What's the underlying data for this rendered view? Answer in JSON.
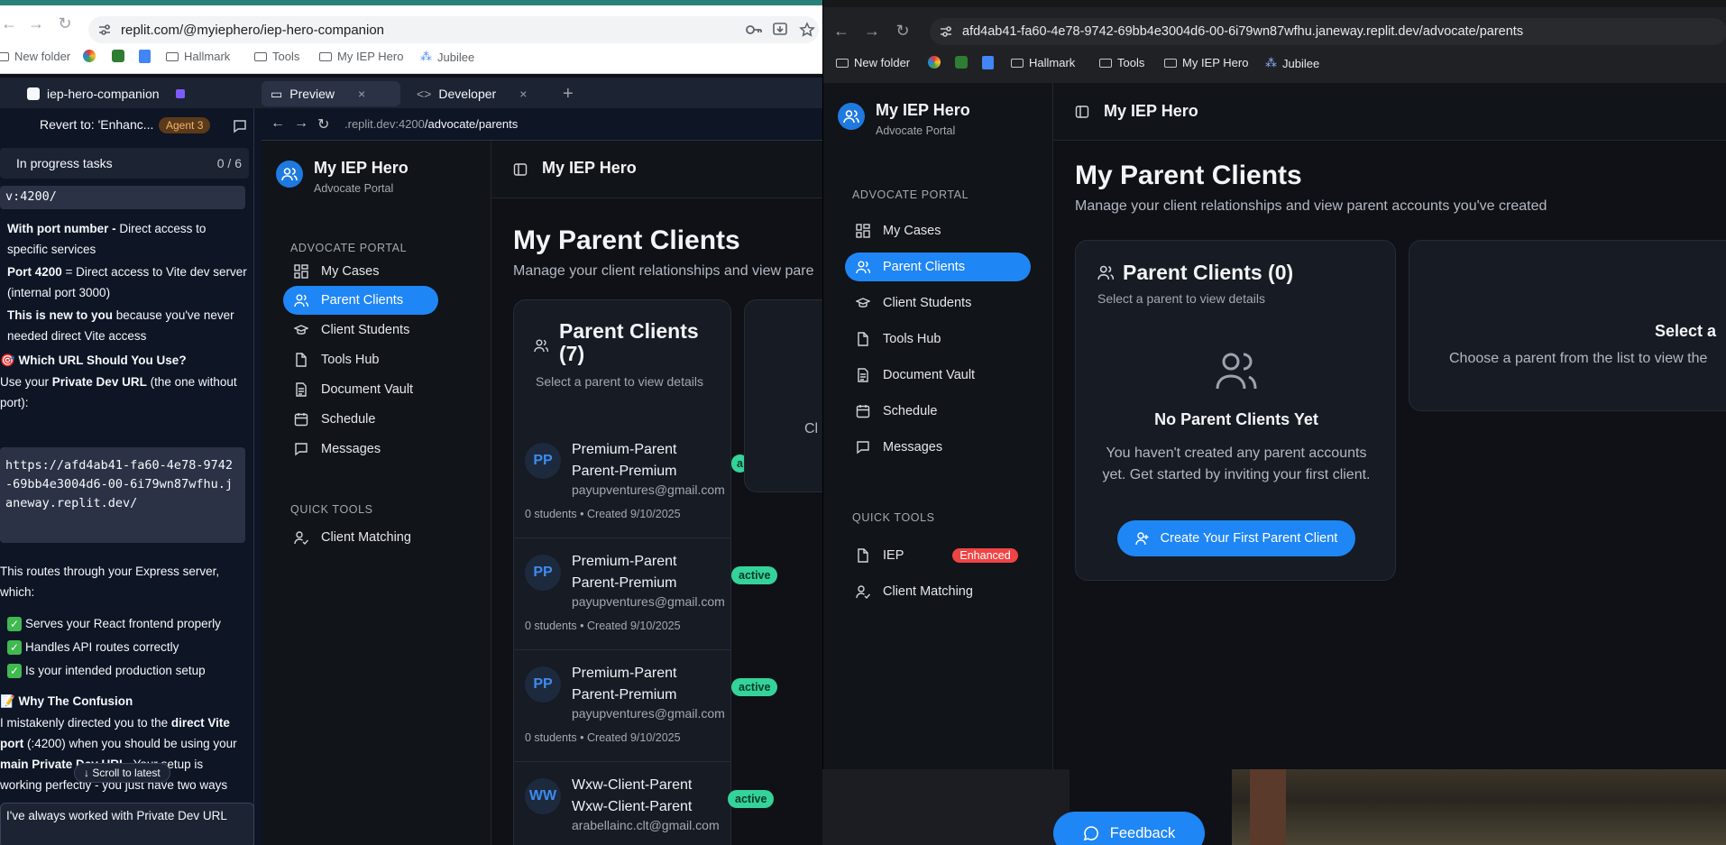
{
  "left_browser": {
    "url": "replit.com/@myiephero/iep-hero-companion",
    "bookmarks": [
      "New folder",
      "Hallmark",
      "Tools",
      "My IEP Hero",
      "Jubilee"
    ]
  },
  "replit": {
    "project_tab": "iep-hero-companion",
    "tabs": [
      "Preview",
      "Developer"
    ],
    "revert_label": "Revert to: 'Enhanc...",
    "agent_badge": "Agent 3",
    "tasks_label": "In progress tasks",
    "tasks_count": "0 / 6",
    "chat": {
      "code_tail": "v:4200/",
      "p1_b": "With port number -",
      "p1": " Direct access to specific services",
      "p2_b": "Port 4200",
      "p2": " = Direct access to Vite dev server (internal port 3000)",
      "p3_b": "This is new to you",
      "p3": " because you've never needed direct Vite access",
      "h1": "🎯 Which URL Should You Use?",
      "p4_a": "Use your ",
      "p4_b": "Private Dev URL",
      "p4_c": " (the one without port):",
      "code": "https://afd4ab41-fa60-4e78-9742-69bb4e3004d6-00-6i79wn87wfhu.janeway.replit.dev/",
      "p5": "This routes through your Express server, which:",
      "check1": "Serves your React frontend properly",
      "check2": "Handles API routes correctly",
      "check3": "Is your intended production setup",
      "h2": "📝 Why The Confusion",
      "p6_a": "I mistakenly directed you to the ",
      "p6_b": "direct Vite port",
      "p6_c": " (:4200) when you should be using your ",
      "p6_d": "main Private Dev URL",
      "p6_e": ". Your setup is working perfectly - you just have two ways",
      "scroll_latest": "Scroll to latest",
      "input_text": "I've always worked with Private Dev URL"
    },
    "preview_url_dim": ".replit.dev:4200",
    "preview_url_path": "/advocate/parents"
  },
  "app_left": {
    "brand": "My IEP Hero",
    "brand_sub": "Advocate Portal",
    "section_portal": "ADVOCATE PORTAL",
    "nav": [
      "My Cases",
      "Parent Clients",
      "Client Students",
      "Tools Hub",
      "Document Vault",
      "Schedule",
      "Messages"
    ],
    "section_tools": "QUICK TOOLS",
    "tools": [
      "Client Matching"
    ],
    "header_title": "My IEP Hero",
    "page_title": "My Parent Clients",
    "page_subtitle": "Manage your client relationships and view pare",
    "card_title": "Parent Clients (7)",
    "card_subtitle": "Select a parent to view details",
    "right_card_text": "Cl",
    "clients": [
      {
        "initials": "PP",
        "name": "Premium-Parent Parent-Premium",
        "email": "payupventures@gmail.com",
        "meta": "0 students • Created 9/10/2025",
        "status": "a"
      },
      {
        "initials": "PP",
        "name": "Premium-Parent Parent-Premium",
        "email": "payupventures@gmail.com",
        "meta": "0 students • Created 9/10/2025",
        "status": "active"
      },
      {
        "initials": "PP",
        "name": "Premium-Parent Parent-Premium",
        "email": "payupventures@gmail.com",
        "meta": "0 students • Created 9/10/2025",
        "status": "active"
      },
      {
        "initials": "WW",
        "name": "Wxw-Client-Parent Wxw-Client-Parent",
        "email": "arabellainc.clt@gmail.com",
        "meta": "",
        "status": "active"
      }
    ],
    "feedback": "Feedback"
  },
  "right_browser": {
    "url": "afd4ab41-fa60-4e78-9742-69bb4e3004d6-00-6i79wn87wfhu.janeway.replit.dev/advocate/parents",
    "bookmarks": [
      "New folder",
      "Hallmark",
      "Tools",
      "My IEP Hero",
      "Jubilee"
    ]
  },
  "app_right": {
    "brand": "My IEP Hero",
    "brand_sub": "Advocate Portal",
    "section_portal": "ADVOCATE PORTAL",
    "nav": [
      "My Cases",
      "Parent Clients",
      "Client Students",
      "Tools Hub",
      "Document Vault",
      "Schedule",
      "Messages"
    ],
    "section_tools": "QUICK TOOLS",
    "tool_iep": "IEP",
    "tool_iep_badge": "Enhanced",
    "tools": [
      "Client Matching"
    ],
    "header_title": "My IEP Hero",
    "page_title": "My Parent Clients",
    "page_subtitle": "Manage your client relationships and view parent accounts you've created",
    "card_title": "Parent Clients (0)",
    "card_subtitle": "Select a parent to view details",
    "empty_title": "No Parent Clients Yet",
    "empty_text": "You haven't created any parent accounts yet. Get started by inviting your first client.",
    "create_button": "Create Your First Parent Client",
    "detail_title": "Select a",
    "detail_text": "Choose a parent from the list to view the"
  },
  "colors": {
    "accent": "#1f86f5",
    "active_badge": "#34d399",
    "enhanced_badge": "#ef4444"
  }
}
